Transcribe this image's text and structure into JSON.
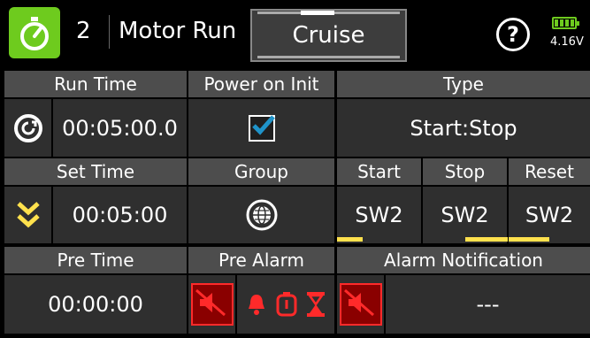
{
  "header": {
    "index": "2",
    "title": "Motor Run",
    "mode": "Cruise",
    "battery_voltage": "4.16V"
  },
  "labels": {
    "run_time": "Run Time",
    "power_on_init": "Power on Init",
    "type": "Type",
    "set_time": "Set Time",
    "group": "Group",
    "start": "Start",
    "stop": "Stop",
    "reset": "Reset",
    "pre_time": "Pre Time",
    "pre_alarm": "Pre Alarm",
    "alarm_notification": "Alarm Notification"
  },
  "values": {
    "run_time": "00:05:00.0",
    "power_on_init_checked": true,
    "type": "Start:Stop",
    "set_time": "00:05:00",
    "start_switch": "SW2",
    "stop_switch": "SW2",
    "reset_switch": "SW2",
    "pre_time": "00:00:00",
    "alarm_notification": "---"
  },
  "switch_levels": {
    "start": 0.3,
    "stop": 0.5,
    "reset": 0.5
  },
  "icons": {
    "app": "stopwatch-icon",
    "reset": "reset-icon",
    "count_down": "double-chevron-down-icon",
    "group": "globe-icon",
    "help": "help-icon",
    "battery": "battery-icon",
    "disabled": "sound-disabled-icon",
    "bell": "bell-icon",
    "timer_box": "timer-icon",
    "hourglass": "hourglass-icon"
  },
  "colors": {
    "app_icon_bg": "#6ecb1e",
    "accent_yellow": "#ffe14d",
    "alert_red": "#ff2a2a",
    "check_blue": "#1f93c9"
  }
}
